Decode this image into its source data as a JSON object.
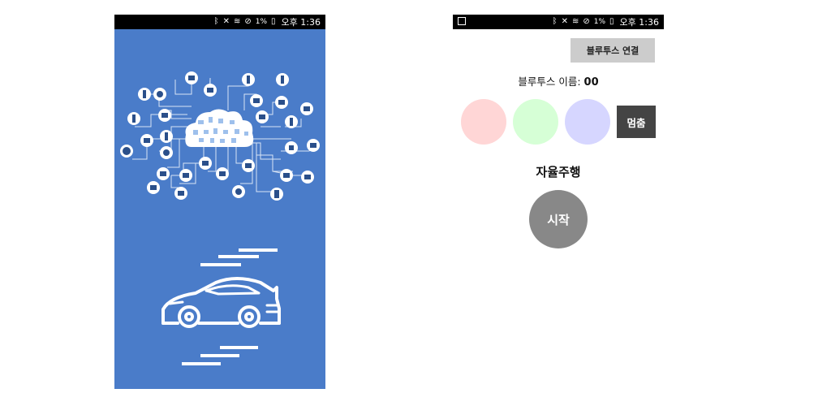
{
  "colors": {
    "splash_bg": "#4a7cc9",
    "statusbar_bg": "#000000",
    "button_gray": "#cccccc",
    "stop_bg": "#444444",
    "start_bg": "#888888",
    "circle_red": "#ffd6d6",
    "circle_green": "#d6ffd6",
    "circle_blue": "#d6d6ff"
  },
  "splash": {
    "statusbar": {
      "icons": [
        "bluetooth-icon",
        "mute-icon",
        "wifi-icon",
        "blocked-icon"
      ],
      "battery_text": "1%",
      "time": "오후 1:36"
    },
    "illustration": [
      "cloud-icon",
      "iot-device-icons",
      "sports-car-icon",
      "speed-lines"
    ]
  },
  "control": {
    "statusbar": {
      "icons": [
        "image-notification-icon",
        "bluetooth-icon",
        "mute-icon",
        "wifi-icon",
        "blocked-icon"
      ],
      "battery_text": "1%",
      "time": "오후 1:36"
    },
    "bt_connect_label": "블루투스 연결",
    "bt_name_label": "블루투스 이름:",
    "bt_name_value": "00",
    "stop_label": "멈춤",
    "auto_title": "자율주행",
    "start_label": "시작"
  }
}
